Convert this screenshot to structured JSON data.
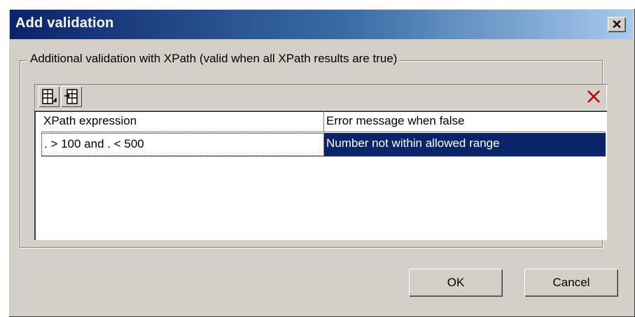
{
  "window": {
    "title": "Add validation",
    "close_label": "✕"
  },
  "group": {
    "label": "Additional validation with XPath (valid when all XPath results are true)"
  },
  "toolbar": {
    "buttons": [
      {
        "icon": "append-row-icon"
      },
      {
        "icon": "insert-row-icon"
      },
      {
        "icon": "delete-icon",
        "color": "#c00000"
      }
    ]
  },
  "table": {
    "columns": [
      "XPath expression",
      "Error message when false"
    ],
    "rows": [
      [
        ". > 100 and . < 500",
        "Number not within allowed range"
      ]
    ],
    "selection_color": "#0a246a"
  },
  "buttons": {
    "ok": "OK",
    "cancel": "Cancel"
  },
  "colors": {
    "title_gradient_start": "#0a246a",
    "title_gradient_end": "#a6caf0",
    "face": "#d4d0c8"
  }
}
